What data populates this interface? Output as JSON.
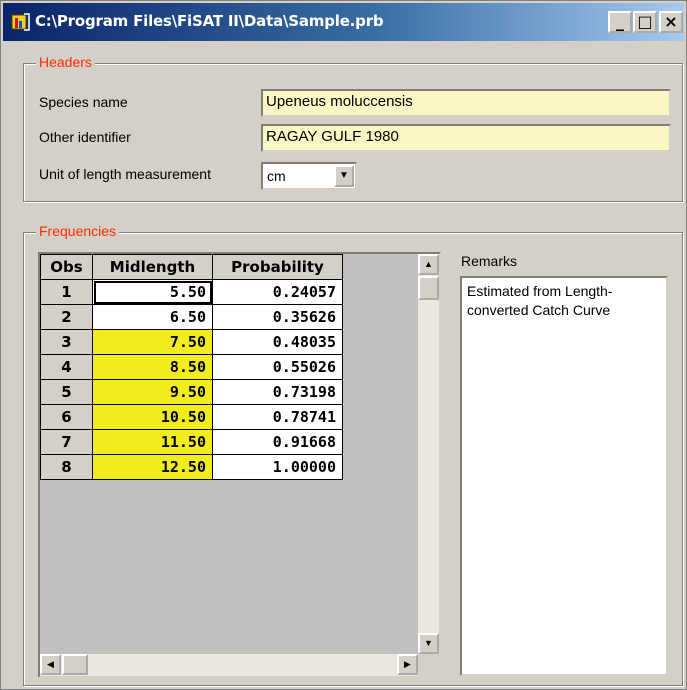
{
  "window": {
    "title": "C:\\Program Files\\FiSAT II\\Data\\Sample.prb",
    "min_glyph": "_",
    "max_glyph": "□",
    "close_glyph": "×"
  },
  "headers": {
    "legend": "Headers",
    "species_label": "Species name",
    "species_value": "Upeneus moluccensis",
    "other_label": "Other identifier",
    "other_value": "RAGAY GULF 1980",
    "unit_label": "Unit of length measurement",
    "unit_value": "cm"
  },
  "frequencies": {
    "legend": "Frequencies",
    "columns": [
      "Obs",
      "Midlength",
      "Probability"
    ],
    "rows": [
      {
        "obs": "1",
        "mid": "5.50",
        "prob": "0.24057"
      },
      {
        "obs": "2",
        "mid": "6.50",
        "prob": "0.35626"
      },
      {
        "obs": "3",
        "mid": "7.50",
        "prob": "0.48035"
      },
      {
        "obs": "4",
        "mid": "8.50",
        "prob": "0.55026"
      },
      {
        "obs": "5",
        "mid": "9.50",
        "prob": "0.73198"
      },
      {
        "obs": "6",
        "mid": "10.50",
        "prob": "0.78741"
      },
      {
        "obs": "7",
        "mid": "11.50",
        "prob": "0.91668"
      },
      {
        "obs": "8",
        "mid": "12.50",
        "prob": "1.00000"
      }
    ],
    "highlight_color": "#f3ec1d",
    "highlighted_rows": [
      3,
      4,
      5,
      6,
      7,
      8
    ]
  },
  "remarks": {
    "label": "Remarks",
    "text": "Estimated from Length-converted Catch Curve"
  },
  "colors": {
    "legend": "#ff2a00",
    "field_bg": "#fbf7c4",
    "titlebar": "#0a246a"
  }
}
